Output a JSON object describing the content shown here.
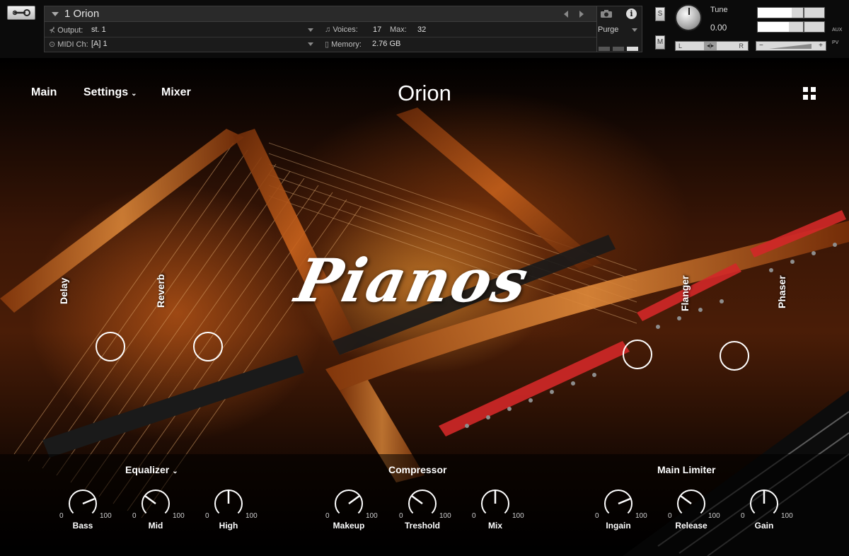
{
  "header": {
    "instrument_name": "1 Orion",
    "output_label": "Output:",
    "output_value": "st. 1",
    "midi_label": "MIDI Ch:",
    "midi_value": "[A]  1",
    "voices_label": "Voices:",
    "voices_value": "17",
    "max_label": "Max:",
    "max_value": "32",
    "memory_label": "Memory:",
    "memory_value": "2.76 GB",
    "purge_label": "Purge",
    "solo_label": "S",
    "mute_label": "M",
    "tune_label": "Tune",
    "tune_value": "0.00",
    "pan_left": "L",
    "pan_center": "◂|▸",
    "pan_right": "R",
    "aux_label": "AUX",
    "pv_label": "PV",
    "minus": "−",
    "plus": "+"
  },
  "nav": {
    "main": "Main",
    "settings": "Settings",
    "settings_chevron": "⌄",
    "mixer": "Mixer",
    "title": "Orion"
  },
  "logo_text": "Pianos",
  "effects": [
    {
      "label": "Delay"
    },
    {
      "label": "Reverb"
    },
    {
      "label": "Flanger"
    },
    {
      "label": "Phaser"
    }
  ],
  "sections": {
    "equalizer": "Equalizer",
    "equalizer_chevron": "⌄",
    "compressor": "Compressor",
    "limiter": "Main Limiter"
  },
  "knobs": [
    {
      "name": "Bass",
      "min": "0",
      "max": "100",
      "value": 75
    },
    {
      "name": "Mid",
      "min": "0",
      "max": "100",
      "value": 30
    },
    {
      "name": "High",
      "min": "0",
      "max": "100",
      "value": 50
    },
    {
      "name": "Makeup",
      "min": "0",
      "max": "100",
      "value": 70
    },
    {
      "name": "Treshold",
      "min": "0",
      "max": "100",
      "value": 30
    },
    {
      "name": "Mix",
      "min": "0",
      "max": "100",
      "value": 50
    },
    {
      "name": "Ingain",
      "min": "0",
      "max": "100",
      "value": 75
    },
    {
      "name": "Release",
      "min": "0",
      "max": "100",
      "value": 30
    },
    {
      "name": "Gain",
      "min": "0",
      "max": "100",
      "value": 50
    }
  ],
  "icons": {
    "wrench": "wrench-icon",
    "camera": "camera-icon",
    "info": "info-icon",
    "grid": "grid-icon"
  }
}
